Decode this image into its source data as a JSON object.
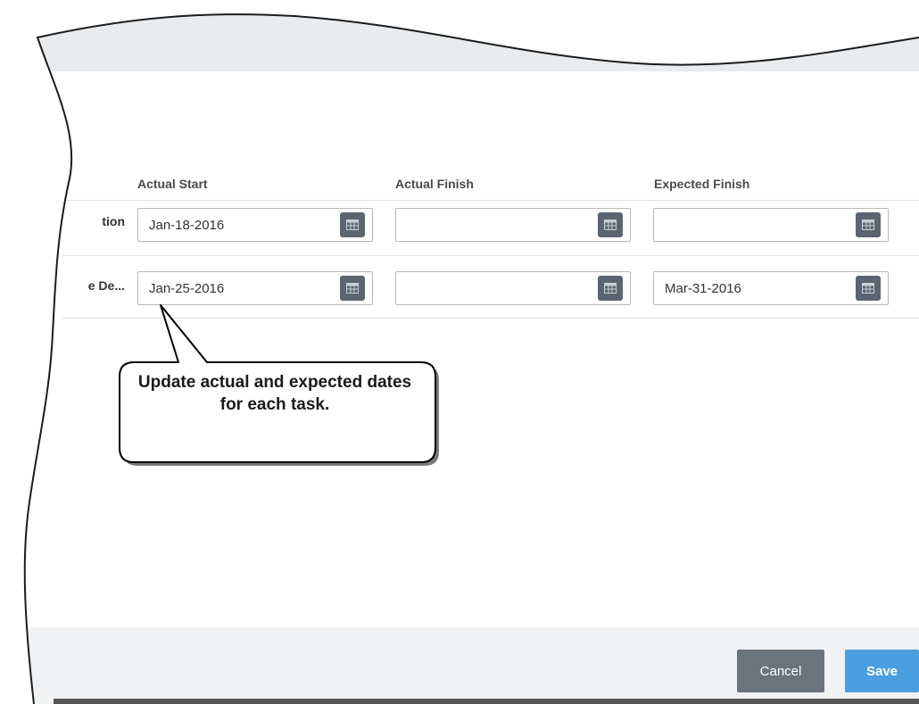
{
  "table": {
    "headers": {
      "actual_start": "Actual Start",
      "actual_finish": "Actual Finish",
      "expected_finish": "Expected Finish"
    },
    "rows": [
      {
        "task": "tion",
        "actual_start": "Jan-18-2016",
        "actual_finish": "",
        "expected_finish": ""
      },
      {
        "task": "e De...",
        "actual_start": "Jan-25-2016",
        "actual_finish": "",
        "expected_finish": "Mar-31-2016"
      }
    ]
  },
  "callout": {
    "text": "Update actual and expected dates for each task."
  },
  "footer": {
    "cancel_label": "Cancel",
    "save_label": "Save"
  },
  "colors": {
    "save_button": "#4a9fe0",
    "cancel_button": "#6b737c",
    "calendar_button": "#5b6470",
    "header_strip": "#e9ecee"
  },
  "icons": {
    "date_picker": "calendar-icon"
  }
}
